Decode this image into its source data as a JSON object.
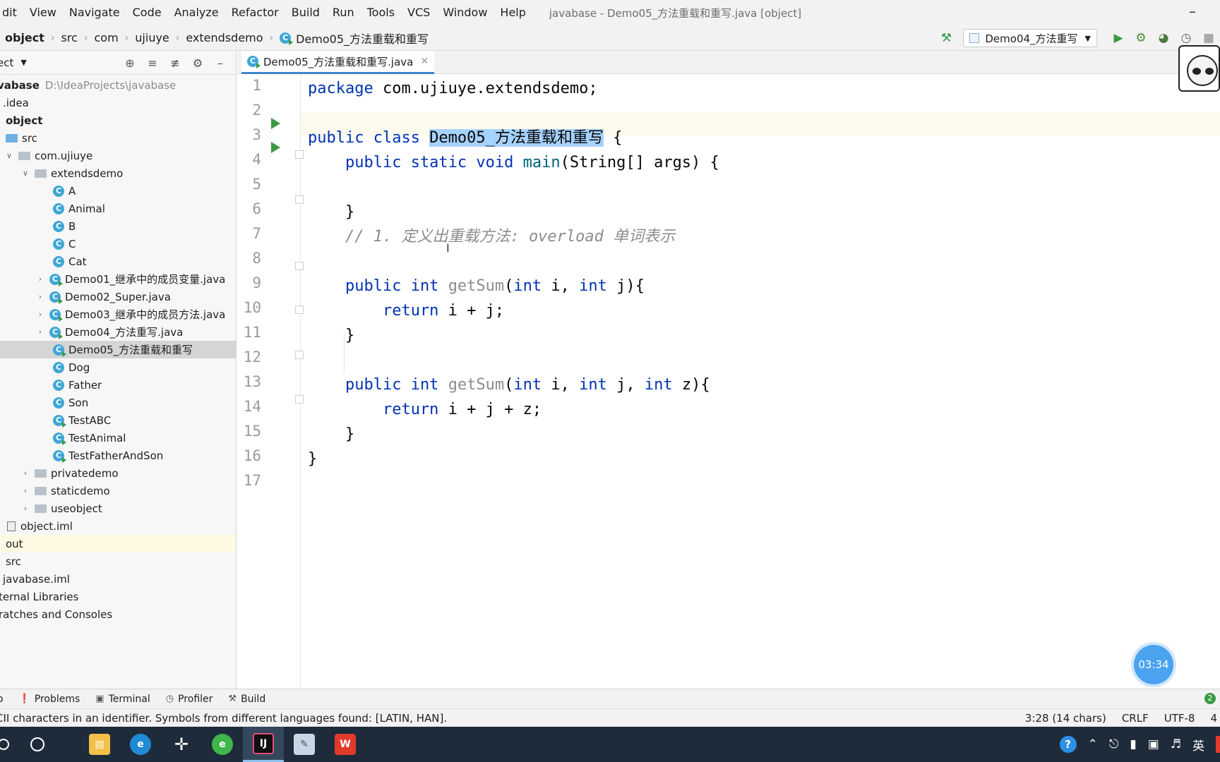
{
  "menu": {
    "items": [
      "dit",
      "View",
      "Navigate",
      "Code",
      "Analyze",
      "Refactor",
      "Build",
      "Run",
      "Tools",
      "VCS",
      "Window",
      "Help"
    ],
    "window_title": "javabase - Demo05_方法重载和重写.java [object]"
  },
  "navbar": {
    "breadcrumbs": [
      "object",
      "src",
      "com",
      "ujiuye",
      "extendsdemo",
      "Demo05_方法重载和重写"
    ],
    "run_config": "Demo04_方法重写"
  },
  "project_panel": {
    "title": "ect",
    "tree": [
      {
        "label": "vabase",
        "path": "D:\\IdeaProjects\\javabase",
        "bold": true
      },
      {
        "label": ".idea"
      },
      {
        "label": "object",
        "bold": true
      },
      {
        "label": "src"
      },
      {
        "label": "com.ujiuye"
      },
      {
        "label": "extendsdemo"
      },
      {
        "label": "A"
      },
      {
        "label": "Animal"
      },
      {
        "label": "B"
      },
      {
        "label": "C"
      },
      {
        "label": "Cat"
      },
      {
        "label": "Demo01_继承中的成员变量.java"
      },
      {
        "label": "Demo02_Super.java"
      },
      {
        "label": "Demo03_继承中的成员方法.java"
      },
      {
        "label": "Demo04_方法重写.java"
      },
      {
        "label": "Demo05_方法重载和重写"
      },
      {
        "label": "Dog"
      },
      {
        "label": "Father"
      },
      {
        "label": "Son"
      },
      {
        "label": "TestABC"
      },
      {
        "label": "TestAnimal"
      },
      {
        "label": "TestFatherAndSon"
      },
      {
        "label": "privatedemo"
      },
      {
        "label": "staticdemo"
      },
      {
        "label": "useobject"
      },
      {
        "label": "object.iml"
      },
      {
        "label": "out"
      },
      {
        "label": "src"
      },
      {
        "label": "javabase.iml"
      },
      {
        "label": "ternal Libraries"
      },
      {
        "label": "ratches and Consoles"
      }
    ]
  },
  "editor": {
    "tab_label": "Demo05_方法重载和重写.java",
    "line_numbers": [
      "1",
      "2",
      "3",
      "4",
      "5",
      "6",
      "7",
      "8",
      "9",
      "10",
      "11",
      "12",
      "13",
      "14",
      "15",
      "16",
      "17"
    ],
    "code": {
      "l1_kw": "package",
      "l1_rest": " com.ujiuye.extendsdemo;",
      "l3_kw": "public class ",
      "l3_name": "Demo05_方法重载和重写",
      "l3_rest": " {",
      "l4_kw": "    public static void ",
      "l4_fn": "main",
      "l4_rest": "(String[] args) {",
      "l6": "    }",
      "l7_comment": "    // 1. 定义出重载方法: overload 单词表示",
      "l9_kw": "    public int ",
      "l9_fn": "getSum",
      "l9_a": "(",
      "l9_k1": "int",
      "l9_b": " i, ",
      "l9_k2": "int",
      "l9_c": " j){",
      "l10_kw": "        return",
      "l10_rest": " i + j;",
      "l11": "    }",
      "l13_kw": "    public int ",
      "l13_fn": "getSum",
      "l13_a": "(",
      "l13_k1": "int",
      "l13_b": " i, ",
      "l13_k2": "int",
      "l13_c": " j, ",
      "l13_k3": "int",
      "l13_d": " z){",
      "l14_kw": "        return",
      "l14_rest": " i + j + z;",
      "l15": "    }",
      "l16": "}"
    },
    "timer": "03:34"
  },
  "tool_windows": [
    "Problems",
    "Terminal",
    "Profiler",
    "Build"
  ],
  "problem_count": "2",
  "status": {
    "message": "CII characters in an identifier. Symbols from different languages found: [LATIN, HAN].",
    "position": "3:28 (14 chars)",
    "line_sep": "CRLF",
    "encoding": "UTF-8",
    "indent": "4"
  },
  "taskbar": {
    "ime": "英",
    "apps": [
      "file-explorer-icon",
      "edge-icon",
      "sublime-icon",
      "browser-icon",
      "intellij-icon",
      "paint-icon",
      "wps-icon"
    ]
  },
  "colors": {
    "keyword": "#0033b3",
    "function": "#00627a",
    "comment": "#8c8c8c",
    "selection": "#a6d2ff",
    "run_green": "#3a9a43"
  }
}
